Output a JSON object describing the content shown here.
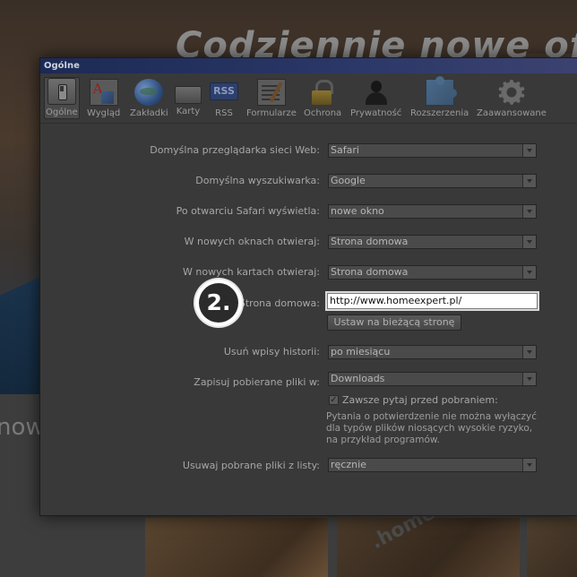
{
  "background": {
    "headline": "Codziennie nowe ofe",
    "strip_text": "now",
    "watermark": ".homeexpert"
  },
  "window": {
    "title": "Ogólne",
    "toolbar": [
      {
        "label": "Ogólne",
        "icon": "switch-icon",
        "selected": true
      },
      {
        "label": "Wygląd",
        "icon": "font-icon"
      },
      {
        "label": "Zakładki",
        "icon": "globe-icon"
      },
      {
        "label": "Karty",
        "icon": "tabs-icon"
      },
      {
        "label": "RSS",
        "icon": "rss-icon"
      },
      {
        "label": "Formularze",
        "icon": "form-pencil-icon"
      },
      {
        "label": "Ochrona",
        "icon": "lock-icon"
      },
      {
        "label": "Prywatność",
        "icon": "person-icon"
      },
      {
        "label": "Rozszerzenia",
        "icon": "puzzle-icon"
      },
      {
        "label": "Zaawansowane",
        "icon": "gear-icon"
      }
    ],
    "rss_icon_text": "RSS",
    "form": {
      "default_browser_label": "Domyślna przeglądarka sieci Web:",
      "default_browser_value": "Safari",
      "default_search_label": "Domyślna wyszukiwarka:",
      "default_search_value": "Google",
      "on_open_label": "Po otwarciu Safari wyświetla:",
      "on_open_value": "nowe okno",
      "new_windows_label": "W nowych oknach otwieraj:",
      "new_windows_value": "Strona domowa",
      "new_tabs_label": "W nowych kartach otwieraj:",
      "new_tabs_value": "Strona domowa",
      "homepage_label": "Strona domowa:",
      "homepage_value": "http://www.homeexpert.pl/",
      "set_current_button": "Ustaw na bieżącą stronę",
      "history_label": "Usuń wpisy historii:",
      "history_value": "po miesiącu",
      "downloads_label": "Zapisuj pobierane pliki w:",
      "downloads_value": "Downloads",
      "ask_before_download": "Zawsze pytaj przed pobraniem:",
      "ask_checked": true,
      "ask_note": "Pytania o potwierdzenie nie można wyłączyć dla typów plików niosących wysokie ryzyko, na przykład programów.",
      "remove_downloads_label": "Usuwaj pobrane pliki z listy:",
      "remove_downloads_value": "ręcznie"
    }
  },
  "step_badge": "2."
}
